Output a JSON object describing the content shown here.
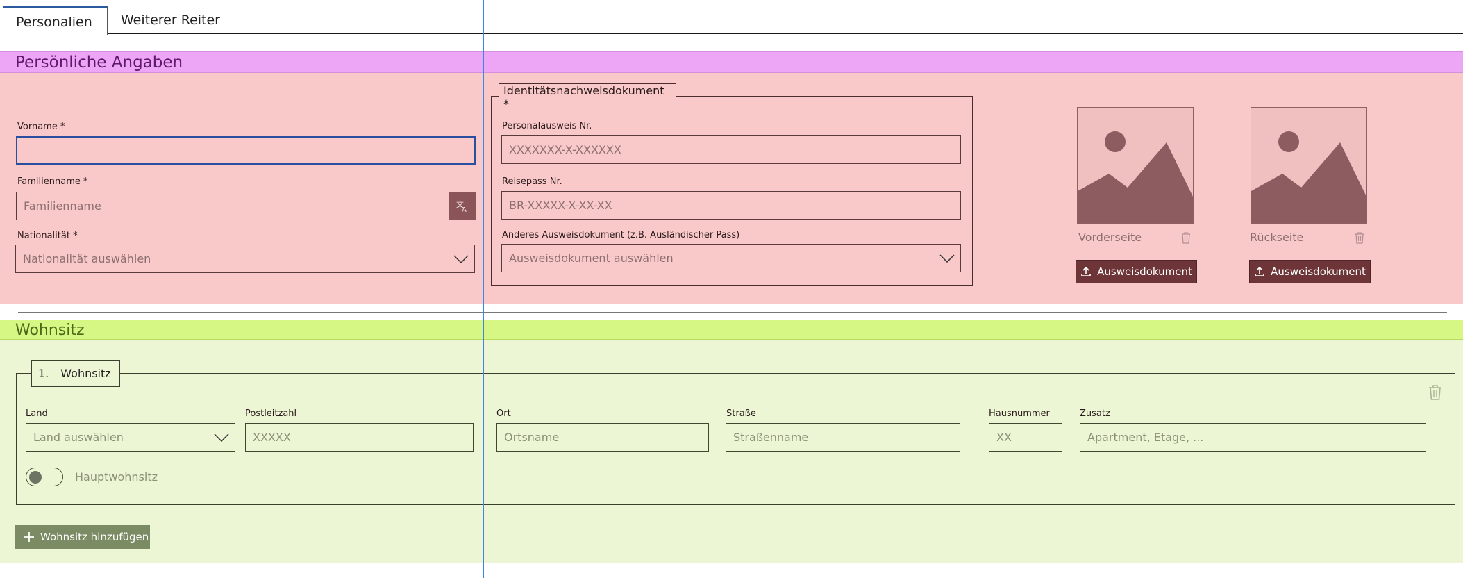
{
  "tabs": [
    {
      "label": "Personalien",
      "active": true
    },
    {
      "label": "Weiterer Reiter",
      "active": false
    }
  ],
  "personal": {
    "section_title": "Persönliche Angaben",
    "vorname": {
      "label": "Vorname *",
      "value": ""
    },
    "familienname": {
      "label": "Familienname *",
      "placeholder": "Familienname",
      "icon": "translate-icon"
    },
    "nationalitaet": {
      "label": "Nationalität *",
      "placeholder": "Nationalität auswählen"
    },
    "id_document": {
      "legend": "Identitätsnachweisdokument *",
      "personalausweis": {
        "label": "Personalausweis Nr.",
        "placeholder": "XXXXXXX-X-XXXXXX"
      },
      "reisepass": {
        "label": "Reisepass Nr.",
        "placeholder": "BR-XXXXX-X-XX-XX"
      },
      "anderes": {
        "label": "Anderes Ausweisdokument (z.B. Ausländischer Pass)",
        "placeholder": "Ausweisdokument auswählen"
      }
    },
    "images": [
      {
        "caption": "Vorderseite",
        "button": "Ausweisdokument"
      },
      {
        "caption": "Rückseite",
        "button": "Ausweisdokument"
      }
    ]
  },
  "wohnsitz": {
    "section_title": "Wohnsitz",
    "entry_legend_num": "1.",
    "entry_legend_text": "Wohnsitz",
    "land": {
      "label": "Land",
      "placeholder": "Land auswählen"
    },
    "plz": {
      "label": "Postleitzahl",
      "placeholder": "XXXXX"
    },
    "ort": {
      "label": "Ort",
      "placeholder": "Ortsname"
    },
    "strasse": {
      "label": "Straße",
      "placeholder": "Straßenname"
    },
    "hausnummer": {
      "label": "Hausnummer",
      "placeholder": "XX"
    },
    "zusatz": {
      "label": "Zusatz",
      "placeholder": "Apartment, Etage, ..."
    },
    "hauptwohnsitz_label": "Hauptwohnsitz",
    "hauptwohnsitz_on": false,
    "add_button": "Wohnsitz hinzufügen"
  },
  "colors": {
    "personal_header": "#eca6f5",
    "personal_body": "#f9c9ca",
    "wohnsitz_header": "#d6f783",
    "wohnsitz_body": "#ecf6d4",
    "button_dark": "#6d3538",
    "button_green": "#7b8c64",
    "guide_lines": "#3e86e0"
  }
}
